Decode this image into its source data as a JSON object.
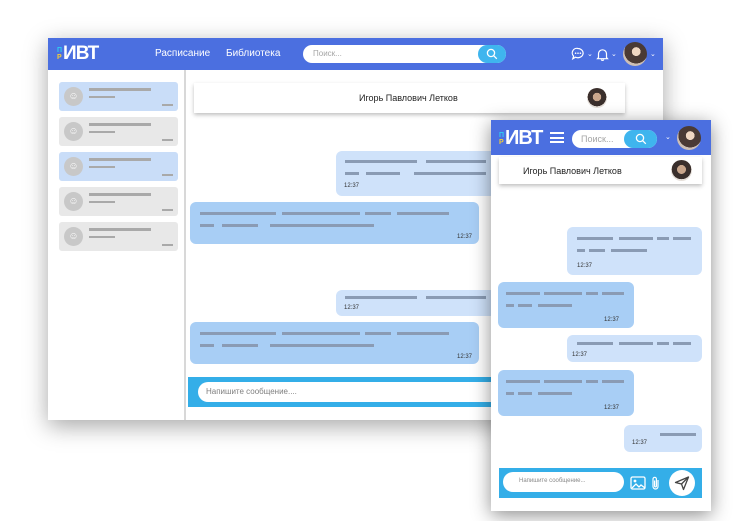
{
  "brand": {
    "small_top": "П",
    "small_bottom": "Р",
    "main": "ИВТ"
  },
  "desktop": {
    "nav": {
      "links": [
        "Расписание",
        "Библиотека"
      ],
      "search_placeholder": "Поиск..."
    },
    "chat_header": {
      "name": "Игорь Павлович Летков"
    },
    "times": [
      "12:37",
      "12:37",
      "12:37",
      "12:37"
    ],
    "input_placeholder": "Напишите сообщение...."
  },
  "mobile": {
    "search_placeholder": "Поиск...",
    "chat_header": {
      "name": "Игорь Павлович Летков"
    },
    "times": [
      "12:37",
      "12:37",
      "12:37",
      "12:37",
      "12:37"
    ],
    "input_placeholder": "Напишите сообщение..."
  },
  "colors": {
    "nav": "#4b6fe0",
    "accent": "#34aee8",
    "bubble_out": "#cfe2fa",
    "bubble_in": "#a8cef5",
    "contact_active": "#c9ddf8",
    "contact_idle": "#e8e8e8"
  },
  "icons": [
    "chat-icon",
    "bell-icon",
    "search-icon",
    "menu-icon",
    "image-icon",
    "paperclip-icon",
    "send-icon",
    "user-icon"
  ]
}
